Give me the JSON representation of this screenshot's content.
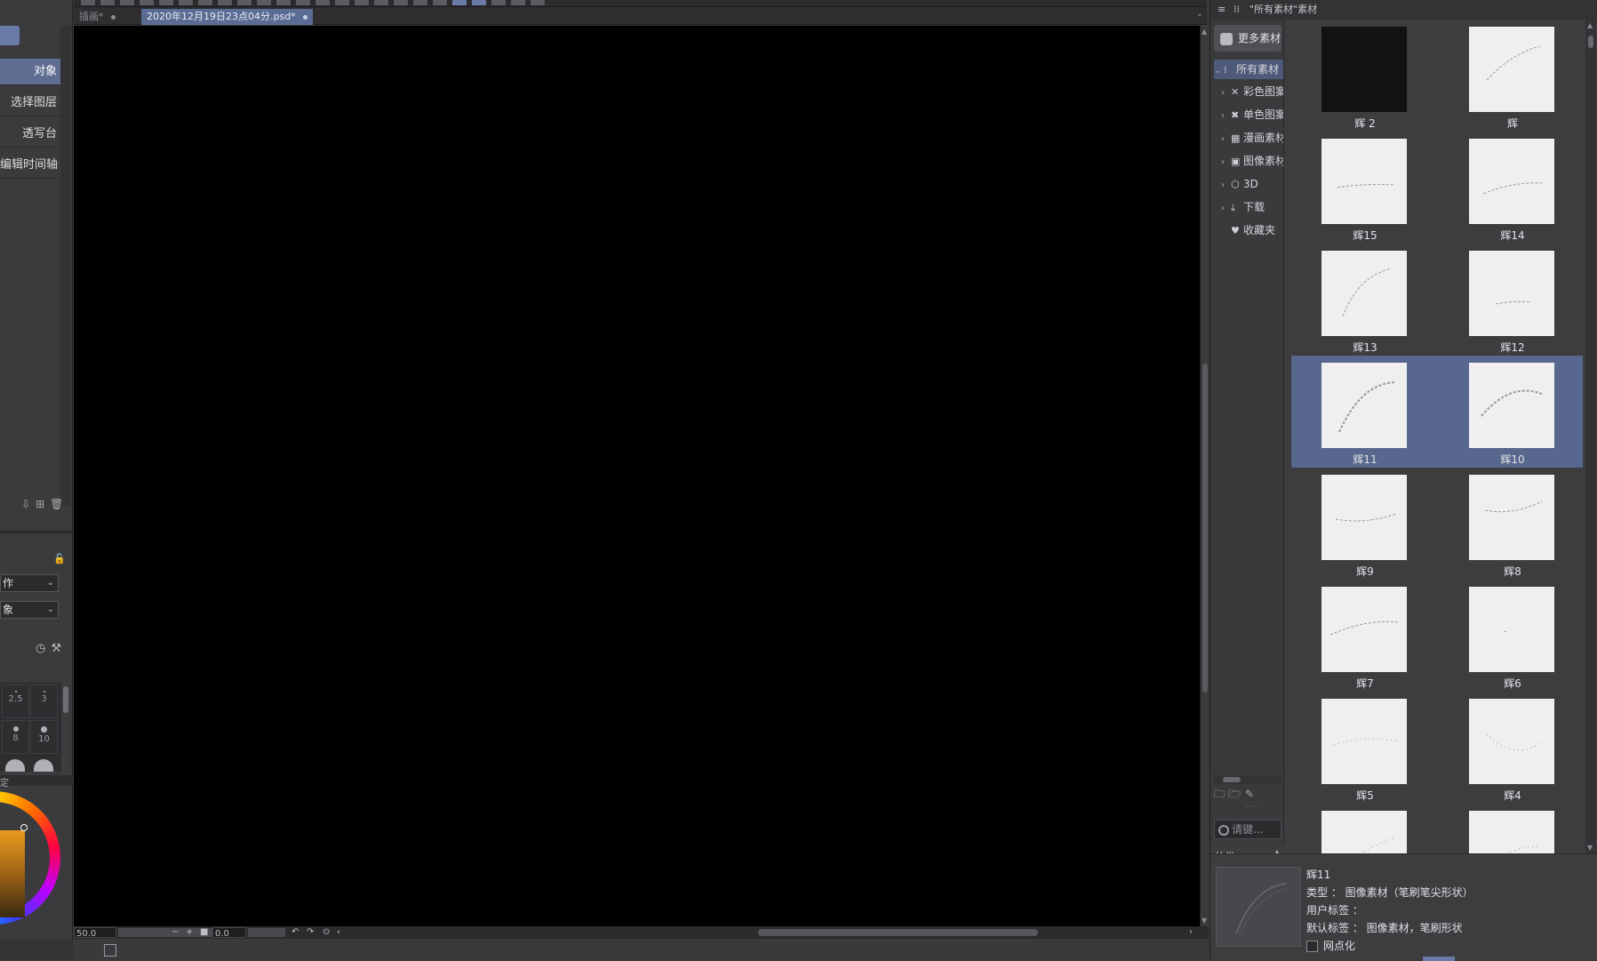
{
  "toolbar": {
    "count": 24
  },
  "tabs": [
    {
      "label": "插画*",
      "active": false
    },
    {
      "label": "2020年12月19日23点04分.psd*",
      "active": true
    }
  ],
  "left_panel": {
    "items": [
      {
        "label": "对象",
        "selected": true
      },
      {
        "label": "选择图层",
        "selected": false
      },
      {
        "label": "透写台",
        "selected": false
      },
      {
        "label": "编辑时间轴",
        "selected": false
      }
    ],
    "select1": "作",
    "select2": "象",
    "brush_sizes": [
      {
        "label": "2.5"
      },
      {
        "label": "3"
      },
      {
        "label": "8"
      },
      {
        "label": "10"
      }
    ],
    "strip_label": "定"
  },
  "status_bar": {
    "zoom": "50.0",
    "angle": "0.0"
  },
  "right_panel": {
    "header_title": "\"所有素材\"素材",
    "more_materials": "更多素材",
    "tree": [
      {
        "label": "所有素材",
        "icon": "grid-icon",
        "expanded": true,
        "selected": true
      },
      {
        "label": "彩色图案",
        "icon": "cross-tools-icon",
        "expanded": false
      },
      {
        "label": "单色图案",
        "icon": "cross-tools-icon",
        "expanded": false
      },
      {
        "label": "漫画素材",
        "icon": "frame-icon",
        "expanded": false
      },
      {
        "label": "图像素材",
        "icon": "image-icon",
        "expanded": false
      },
      {
        "label": "3D",
        "icon": "cube-icon",
        "expanded": false
      },
      {
        "label": "下载",
        "icon": "download-icon",
        "expanded": false
      },
      {
        "label": "收藏夹",
        "icon": "heart-icon",
        "expanded": null
      }
    ],
    "search_placeholder": "请键...",
    "category_label": "分类",
    "materials": [
      {
        "label": "辉 2",
        "dark": true
      },
      {
        "label": "辉",
        "dark": false
      },
      {
        "label": "辉15",
        "dark": false
      },
      {
        "label": "辉14",
        "dark": false
      },
      {
        "label": "辉13",
        "dark": false
      },
      {
        "label": "辉12",
        "dark": false
      },
      {
        "label": "辉11",
        "dark": false,
        "selected": true
      },
      {
        "label": "辉10",
        "dark": false,
        "selected": true
      },
      {
        "label": "辉9",
        "dark": false
      },
      {
        "label": "辉8",
        "dark": false
      },
      {
        "label": "辉7",
        "dark": false
      },
      {
        "label": "辉6",
        "dark": false
      },
      {
        "label": "辉5",
        "dark": false
      },
      {
        "label": "辉4",
        "dark": false
      },
      {
        "label": "",
        "dark": false
      },
      {
        "label": "",
        "dark": false
      }
    ],
    "detail": {
      "name": "辉11",
      "type": "类型 ： 图像素材（笔刷笔尖形状）",
      "user_tag": "用户标签 ：",
      "default_tag": "默认标签 ： 图像素材，笔刷形状",
      "checkbox_label": "网点化"
    }
  }
}
